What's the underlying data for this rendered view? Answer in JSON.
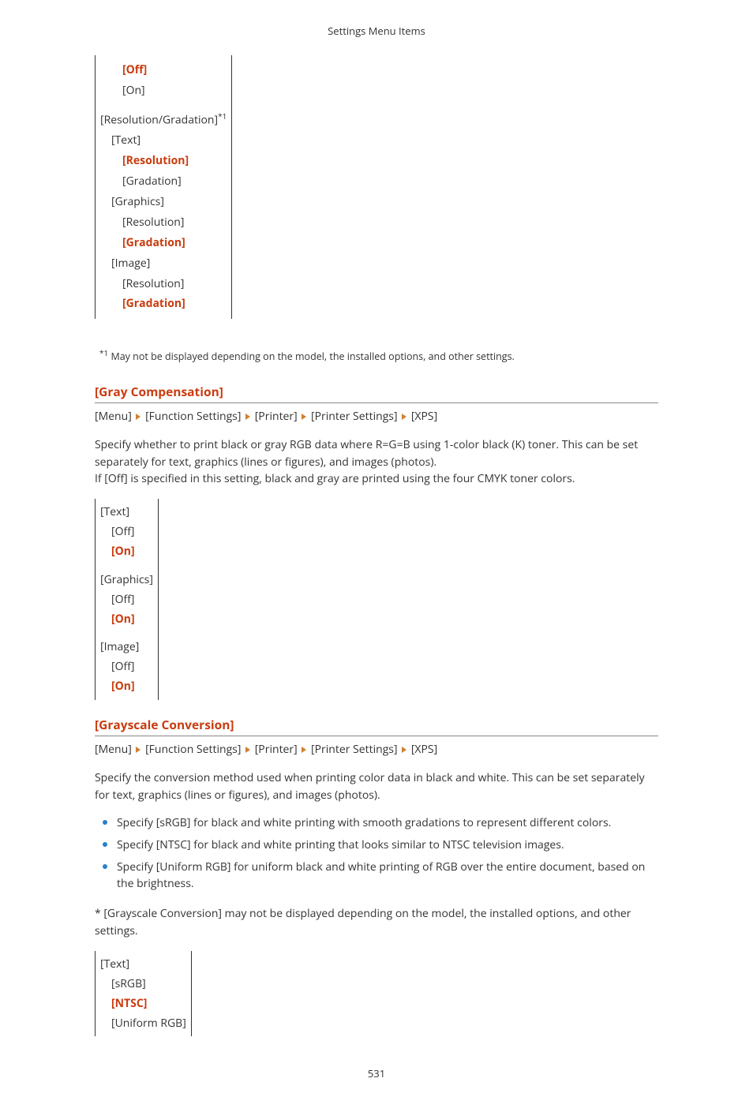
{
  "header": {
    "title": "Settings Menu Items"
  },
  "box1": {
    "items": [
      {
        "text": "[Off]",
        "cls": "lvl2 bold-red"
      },
      {
        "text": "[On]",
        "cls": "lvl2"
      }
    ],
    "second": {
      "heading_text": "[Resolution/Gradation]",
      "sup": "*1",
      "groups": [
        {
          "label": "[Text]",
          "opts": [
            {
              "text": "[Resolution]",
              "bold": true
            },
            {
              "text": "[Gradation]",
              "bold": false
            }
          ]
        },
        {
          "label": "[Graphics]",
          "opts": [
            {
              "text": "[Resolution]",
              "bold": false
            },
            {
              "text": "[Gradation]",
              "bold": true
            }
          ]
        },
        {
          "label": "[Image]",
          "opts": [
            {
              "text": "[Resolution]",
              "bold": false
            },
            {
              "text": "[Gradation]",
              "bold": true
            }
          ]
        }
      ]
    }
  },
  "footnote1": {
    "sup": "*1",
    "text": " May not be displayed depending on the model, the installed options, and other settings."
  },
  "gray_comp": {
    "heading": "[Gray Compensation]",
    "breadcrumb": [
      "[Menu]",
      "[Function Settings]",
      "[Printer]",
      "[Printer Settings]",
      "[XPS]"
    ],
    "para1": "Specify whether to print black or gray RGB data where R=G=B using 1-color black (K) toner. This can be set separately for text, graphics (lines or figures), and images (photos).",
    "para2": "If [Off] is specified in this setting, black and gray are printed using the four CMYK toner colors.",
    "groups": [
      {
        "label": "[Text]",
        "opts": [
          {
            "text": "[Off]",
            "bold": false
          },
          {
            "text": "[On]",
            "bold": true
          }
        ]
      },
      {
        "label": "[Graphics]",
        "opts": [
          {
            "text": "[Off]",
            "bold": false
          },
          {
            "text": "[On]",
            "bold": true
          }
        ]
      },
      {
        "label": "[Image]",
        "opts": [
          {
            "text": "[Off]",
            "bold": false
          },
          {
            "text": "[On]",
            "bold": true
          }
        ]
      }
    ]
  },
  "grayscale": {
    "heading": "[Grayscale Conversion]",
    "breadcrumb": [
      "[Menu]",
      "[Function Settings]",
      "[Printer]",
      "[Printer Settings]",
      "[XPS]"
    ],
    "para": "Specify the conversion method used when printing color data in black and white. This can be set separately for text, graphics (lines or figures), and images (photos).",
    "bullets": [
      "Specify [sRGB] for black and white printing with smooth gradations to represent different colors.",
      "Specify [NTSC] for black and white printing that looks similar to NTSC television images.",
      "Specify [Uniform RGB] for uniform black and white printing of RGB over the entire document, based on the brightness."
    ],
    "note": "* [Grayscale Conversion] may not be displayed depending on the model, the installed options, and other settings.",
    "groups": [
      {
        "label": "[Text]",
        "opts": [
          {
            "text": "[sRGB]",
            "bold": false
          },
          {
            "text": "[NTSC]",
            "bold": true
          },
          {
            "text": "[Uniform RGB]",
            "bold": false
          }
        ]
      }
    ]
  },
  "page_number": "531"
}
